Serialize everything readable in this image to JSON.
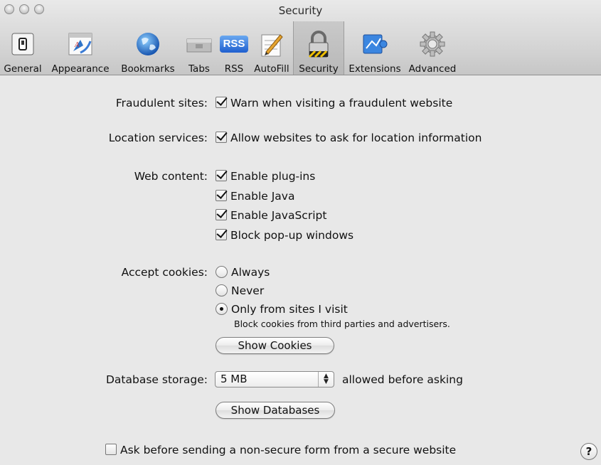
{
  "window": {
    "title": "Security"
  },
  "toolbar": {
    "items": [
      {
        "label": "General",
        "icon": "general-switch-icon"
      },
      {
        "label": "Appearance",
        "icon": "appearance-icon"
      },
      {
        "label": "Bookmarks",
        "icon": "globe-icon"
      },
      {
        "label": "Tabs",
        "icon": "tabs-icon"
      },
      {
        "label": "RSS",
        "icon": "rss-icon",
        "icon_text": "RSS"
      },
      {
        "label": "AutoFill",
        "icon": "autofill-icon"
      },
      {
        "label": "Security",
        "icon": "lock-icon",
        "selected": true
      },
      {
        "label": "Extensions",
        "icon": "puzzle-icon"
      },
      {
        "label": "Advanced",
        "icon": "gear-icon"
      }
    ]
  },
  "fraudulent": {
    "label": "Fraudulent sites:",
    "option": "Warn when visiting a fraudulent website",
    "checked": true
  },
  "location": {
    "label": "Location services:",
    "option": "Allow websites to ask for location information",
    "checked": true
  },
  "web_content": {
    "label": "Web content:",
    "options": [
      {
        "label": "Enable plug-ins",
        "checked": true
      },
      {
        "label": "Enable Java",
        "checked": true
      },
      {
        "label": "Enable JavaScript",
        "checked": true
      },
      {
        "label": "Block pop-up windows",
        "checked": true
      }
    ]
  },
  "cookies": {
    "label": "Accept cookies:",
    "options": [
      {
        "label": "Always",
        "selected": false
      },
      {
        "label": "Never",
        "selected": false
      },
      {
        "label": "Only from sites I visit",
        "selected": true
      }
    ],
    "hint": "Block cookies from third parties and advertisers.",
    "show_button": "Show Cookies"
  },
  "database": {
    "label": "Database storage:",
    "value": "5 MB",
    "suffix": "allowed before asking",
    "show_button": "Show Databases"
  },
  "non_secure_form": {
    "label": "Ask before sending a non-secure form from a secure website",
    "checked": false
  },
  "help": {
    "label": "?"
  }
}
